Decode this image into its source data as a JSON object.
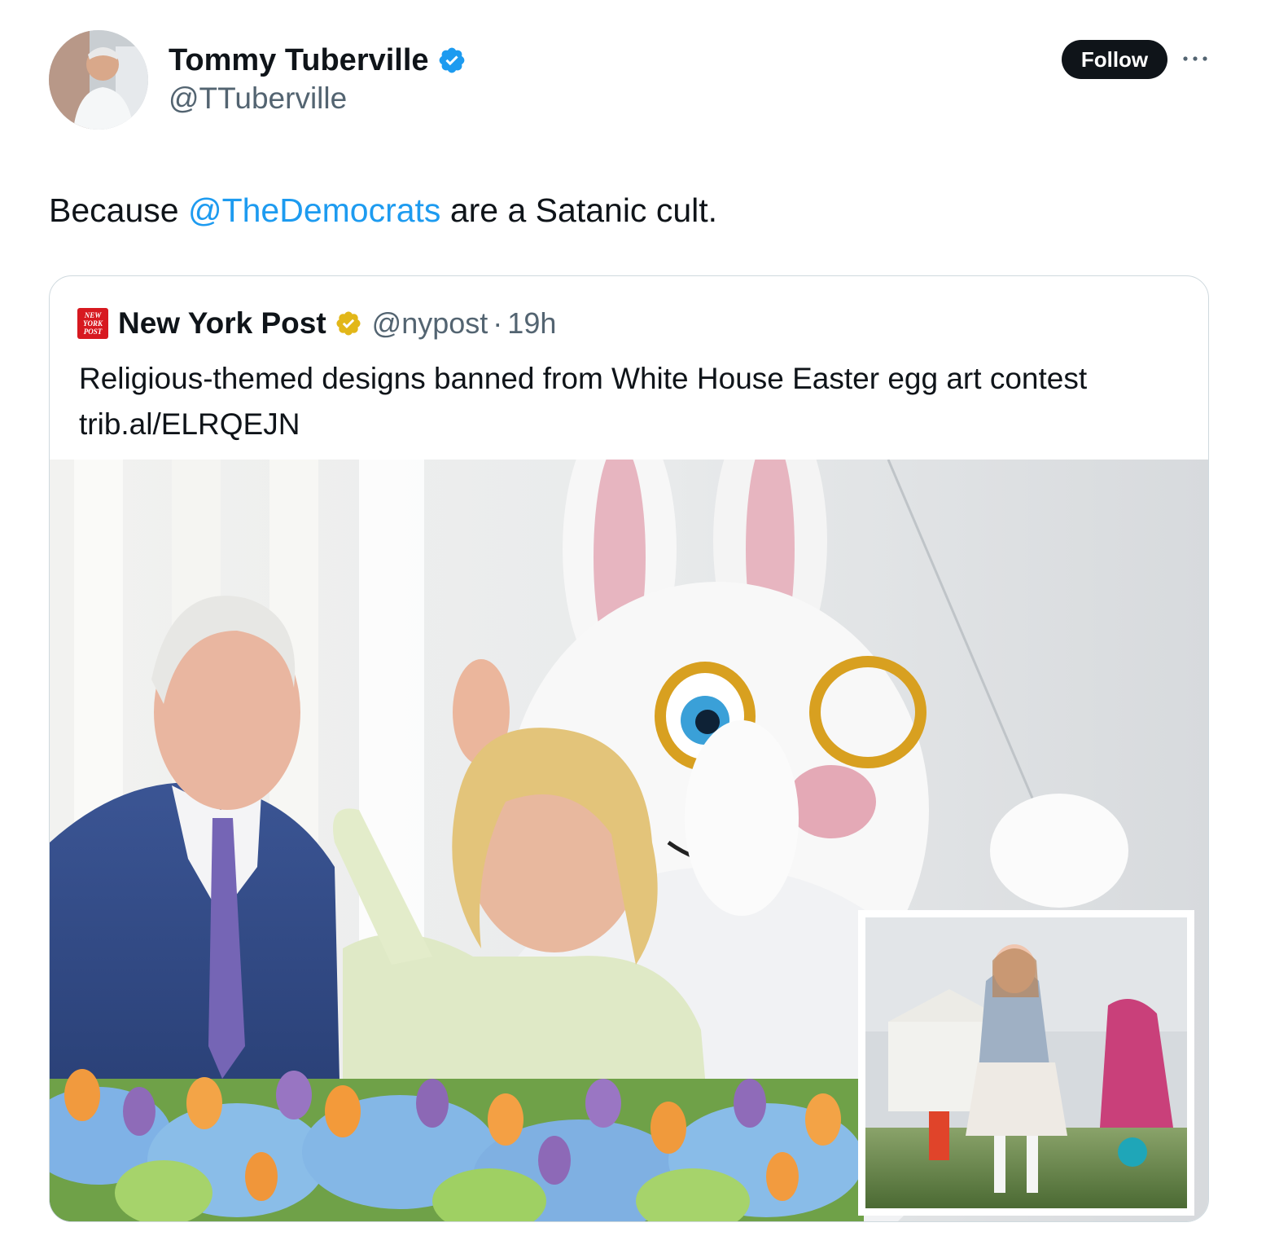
{
  "tweet": {
    "author": {
      "name": "Tommy Tuberville",
      "handle": "@TTuberville",
      "verified_color": "#1d9bf0"
    },
    "follow_label": "Follow",
    "text_before": "Because ",
    "mention": "@TheDemocrats",
    "text_after": " are a Satanic cult."
  },
  "quote": {
    "author": {
      "name": "New York Post",
      "handle": "@nypost",
      "verified_color": "#e2b719"
    },
    "separator": "·",
    "time": "19h",
    "text": "Religious-themed designs banned from White House Easter egg art contest",
    "link": "trib.al/ELRQEJN",
    "logo_text": [
      "NEW",
      "YORK",
      "POST"
    ]
  },
  "colors": {
    "accent": "#1d9bf0",
    "text": "#0f1419",
    "secondary": "#536471",
    "border": "#cfd9de"
  },
  "icons": {
    "verified": "verified-badge-icon",
    "more": "more-horizontal-icon"
  }
}
